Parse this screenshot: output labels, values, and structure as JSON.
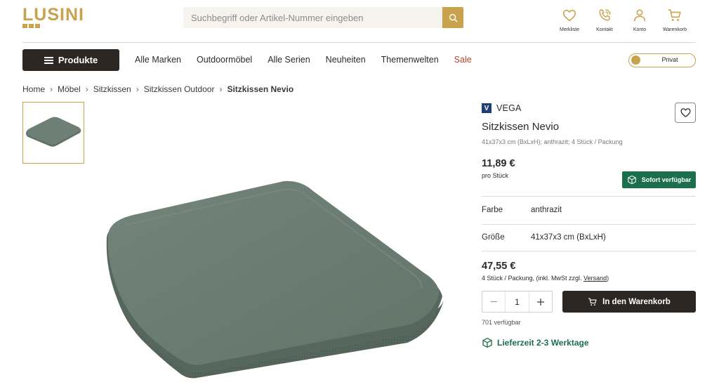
{
  "brand": {
    "logo_text": "LUSINI",
    "logo_color": "#c9a24e"
  },
  "search": {
    "placeholder": "Suchbegriff oder Artikel-Nummer eingeben",
    "value": "",
    "icon": "search-icon"
  },
  "header_icons": [
    {
      "label": "Merkliste",
      "icon": "heart-icon"
    },
    {
      "label": "Kontakt",
      "icon": "phone-icon"
    },
    {
      "label": "Konto",
      "icon": "user-icon"
    },
    {
      "label": "Warenkorb",
      "icon": "cart-icon"
    }
  ],
  "nav": {
    "products_label": "Produkte",
    "items": [
      "Alle Marken",
      "Outdoormöbel",
      "Alle Serien",
      "Neuheiten",
      "Themenwelten",
      "Sale"
    ],
    "sale_color": "#b5442a",
    "customer_toggle": "Privat"
  },
  "breadcrumb": [
    "Home",
    "Möbel",
    "Sitzkissen",
    "Sitzkissen Outdoor",
    "Sitzkissen Nevio"
  ],
  "product": {
    "brand_initial": "V",
    "brand": "VEGA",
    "title": "Sitzkissen Nevio",
    "subtitle": "41x37x3 cm (BxLxH); anthrazit; 4 Stück / Packung",
    "unit_price": "11,89 €",
    "unit_price_note": "pro Stück",
    "stock_badge": "Sofort verfügbar",
    "attributes": [
      {
        "label": "Farbe",
        "value": "anthrazit"
      },
      {
        "label": "Größe",
        "value": "41x37x3 cm (BxLxH)"
      }
    ],
    "pack_price": "47,55 €",
    "pack_note": "4 Stück / Packung, (inkl. MwSt zzgl. ",
    "pack_note_link": "Versand",
    "pack_note_end": ")",
    "quantity": "1",
    "cart_label": "In den Warenkorb",
    "availability": "701 verfügbar",
    "delivery": "Lieferzeit 2-3 Werktage"
  },
  "colors": {
    "accent": "#c9a24e",
    "dark": "#2d2723",
    "green": "#1c6f4d",
    "cushion": "#6a7b71"
  }
}
